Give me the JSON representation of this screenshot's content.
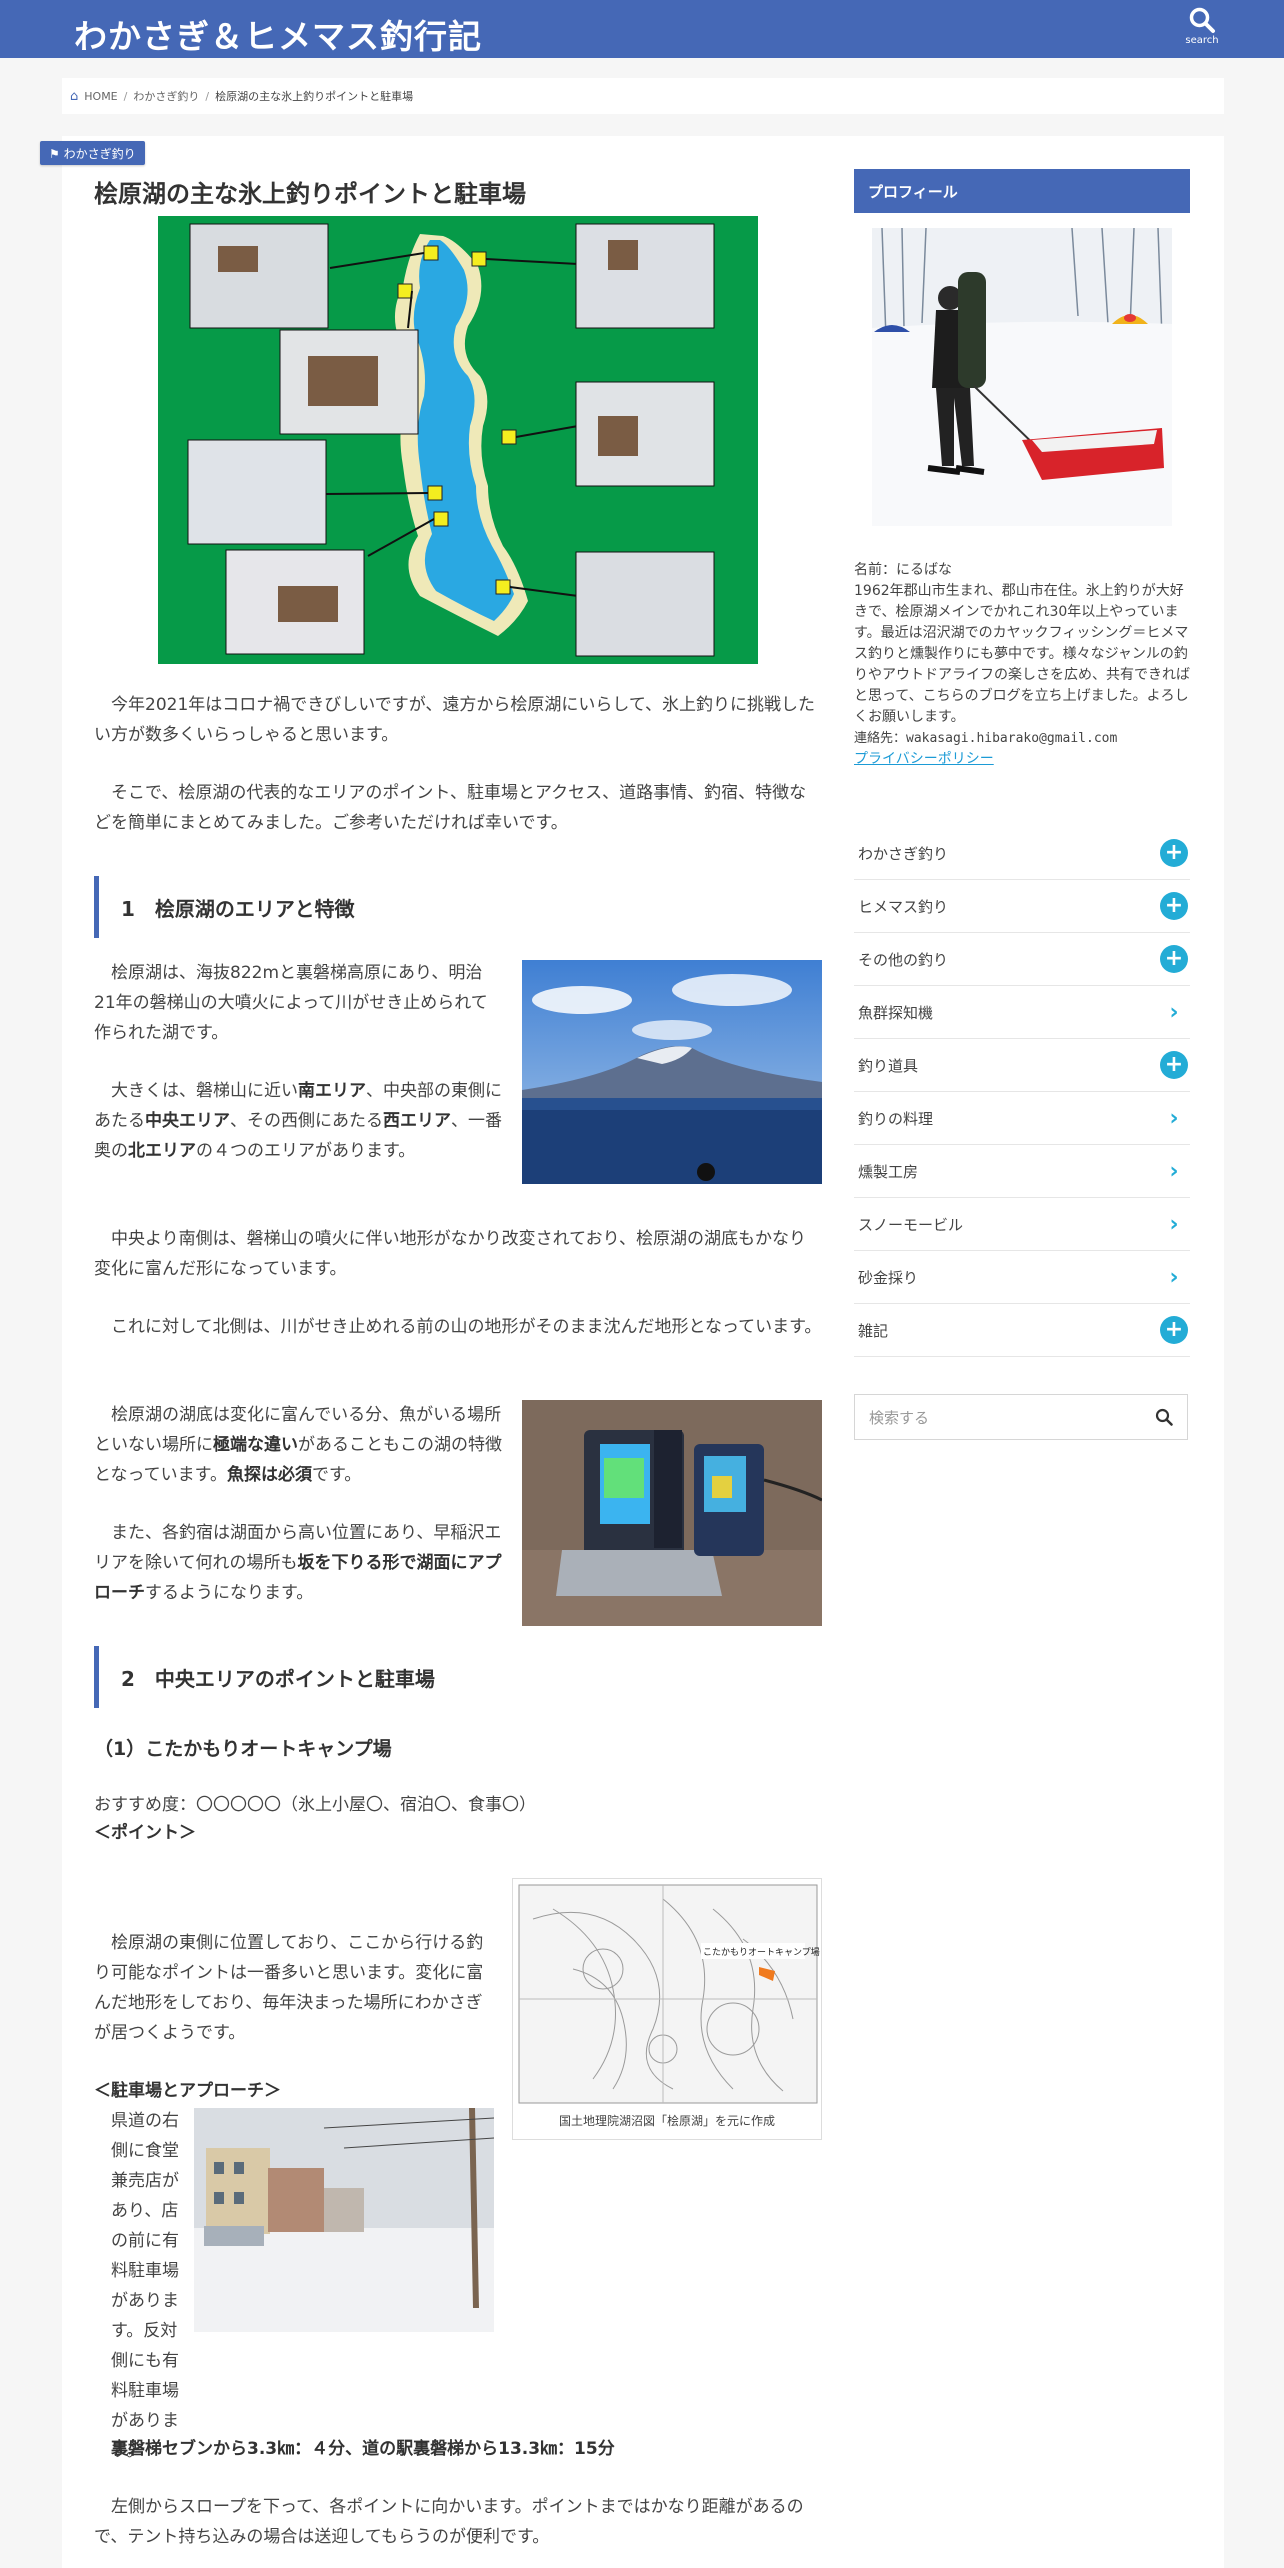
{
  "header": {
    "site_title": "わかさぎ＆ヒメマス釣行記",
    "search_label": "search"
  },
  "breadcrumb": {
    "home": "HOME",
    "category": "わかさぎ釣り",
    "current": "桧原湖の主な氷上釣りポイントと駐車場"
  },
  "post": {
    "category_badge": "わかさぎ釣り",
    "title": "桧原湖の主な氷上釣りポイントと駐車場",
    "intro_1": "今年2021年はコロナ禍できびしいですが、遠方から桧原湖にいらして、氷上釣りに挑戦したい方が数多くいらっしゃると思います。",
    "intro_2": "そこで、桧原湖の代表的なエリアのポイント、駐車場とアクセス、道路事情、釣宿、特徴などを簡単にまとめてみました。ご参考いただければ幸いです。",
    "section1_title": "1　桧原湖のエリアと特徴",
    "s1_p1": "桧原湖は、海抜822mと裏磐梯高原にあり、明治21年の磐梯山の大噴火によって川がせき止められて作られた湖です。",
    "s1_p2_a": "大きくは、磐梯山に近い",
    "s1_p2_b": "南エリア",
    "s1_p2_c": "、中央部の東側にあたる",
    "s1_p2_d": "中央エリア",
    "s1_p2_e": "、その西側にあたる",
    "s1_p2_f": "西エリア",
    "s1_p2_g": "、一番奥の",
    "s1_p2_h": "北エリア",
    "s1_p2_i": "の４つのエリアがあります。",
    "s1_p3": "中央より南側は、磐梯山の噴火に伴い地形がなかり改変されており、桧原湖の湖底もかなり変化に富んだ形になっています。",
    "s1_p4": "これに対して北側は、川がせき止めれる前の山の地形がそのまま沈んだ地形となっています。",
    "s1_p5_a": "桧原湖の湖底は変化に富んでいる分、魚がいる場所といない場所に",
    "s1_p5_b": "極端な違い",
    "s1_p5_c": "があることもこの湖の特徴となっています。",
    "s1_p5_d": "魚探は必須",
    "s1_p5_e": "です。",
    "s1_p6_a": "また、各釣宿は湖面から高い位置にあり、早稲沢エリアを除いて何れの場所も",
    "s1_p6_b": "坂を下りる形で湖面にアプローチ",
    "s1_p6_c": "するようになります。",
    "section2_title": "2　中央エリアのポイントと駐車場",
    "sub1_title": "（1）こたかもりオートキャンプ場",
    "recommend": "おすすめ度：〇〇〇〇〇（氷上小屋〇、宿泊〇、食事〇）",
    "point_head": "＜ポイント＞",
    "point_text": "桧原湖の東側に位置しており、ここから行ける釣り可能なポイントは一番多いと思います。変化に富んだ地形をしており、毎年決まった場所にわかさぎが居つくようです。",
    "map_caption": "国土地理院湖沼図「桧原湖」を元に作成",
    "map_label": "こたかもりオートキャンプ場",
    "parking_head": "＜駐車場とアプローチ＞",
    "parking_text": "県道の右側に食堂兼売店があり、店の前に有料駐車場があります。反対側にも有料駐車場があります。",
    "access_bold": "裏磐梯セブンから3.3㎞：４分、道の駅裏磐梯から13.3㎞：15分",
    "last_text": "左側からスロープを下って、各ポイントに向かいます。ポイントまではかなり距離があるので、テント持ち込みの場合は送迎してもらうのが便利です。"
  },
  "sidebar": {
    "profile_title": "プロフィール",
    "profile_name": "名前：にるばな",
    "profile_bio": "1962年郡山市生まれ、郡山市在住。氷上釣りが大好きで、桧原湖メインでかれこれ30年以上やっています。最近は沼沢湖でのカヤックフィッシング＝ヒメマス釣りと燻製作りにも夢中です。様々なジャンルの釣りやアウトドアライフの楽しさを広め、共有できればと思って、こちらのブログを立ち上げました。よろしくお願いします。",
    "profile_contact": "連絡先：wakasagi.hibarako@gmail.com",
    "privacy_link": "プライバシーポリシー",
    "categories": [
      {
        "label": "わかさぎ釣り",
        "icon": "plus"
      },
      {
        "label": "ヒメマス釣り",
        "icon": "plus"
      },
      {
        "label": "その他の釣り",
        "icon": "plus"
      },
      {
        "label": "魚群探知機",
        "icon": "chevron"
      },
      {
        "label": "釣り道具",
        "icon": "plus"
      },
      {
        "label": "釣りの料理",
        "icon": "chevron"
      },
      {
        "label": "燻製工房",
        "icon": "chevron"
      },
      {
        "label": "スノーモービル",
        "icon": "chevron"
      },
      {
        "label": "砂金採り",
        "icon": "chevron"
      },
      {
        "label": "雑記",
        "icon": "plus"
      }
    ],
    "search_placeholder": "検索する"
  },
  "colors": {
    "brand": "#4568b6",
    "accent": "#23acd6",
    "map_green": "#069a48",
    "lake_blue": "#2aa8e2"
  }
}
